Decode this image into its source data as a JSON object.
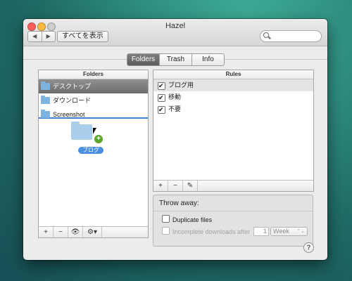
{
  "window": {
    "title": "Hazel"
  },
  "toolbar": {
    "back": "◀",
    "forward": "▶",
    "show_all": "すべてを表示",
    "search_placeholder": ""
  },
  "tabs": [
    {
      "label": "Folders",
      "active": true
    },
    {
      "label": "Trash",
      "active": false
    },
    {
      "label": "Info",
      "active": false
    }
  ],
  "folders": {
    "header": "Folders",
    "items": [
      {
        "name": "デスクトップ",
        "selected": true
      },
      {
        "name": "ダウンロード",
        "selected": false
      },
      {
        "name": "Screenshot",
        "selected": false
      }
    ],
    "drag_label": "ブログ",
    "buttons": {
      "add": "+",
      "remove": "−",
      "preview": "👁",
      "gear": "⚙▾"
    }
  },
  "rules": {
    "header": "Rules",
    "items": [
      {
        "name": "ブログ用",
        "checked": true,
        "selected": true
      },
      {
        "name": "移動",
        "checked": true,
        "selected": false
      },
      {
        "name": "不要",
        "checked": true,
        "selected": false
      }
    ],
    "buttons": {
      "add": "+",
      "remove": "−",
      "edit": "✎"
    }
  },
  "throw_away": {
    "header": "Throw away:",
    "duplicate_label": "Duplicate files",
    "incomplete_label": "Incomplete downloads after",
    "incomplete_value": "1",
    "incomplete_unit": "Week"
  },
  "help": "?"
}
